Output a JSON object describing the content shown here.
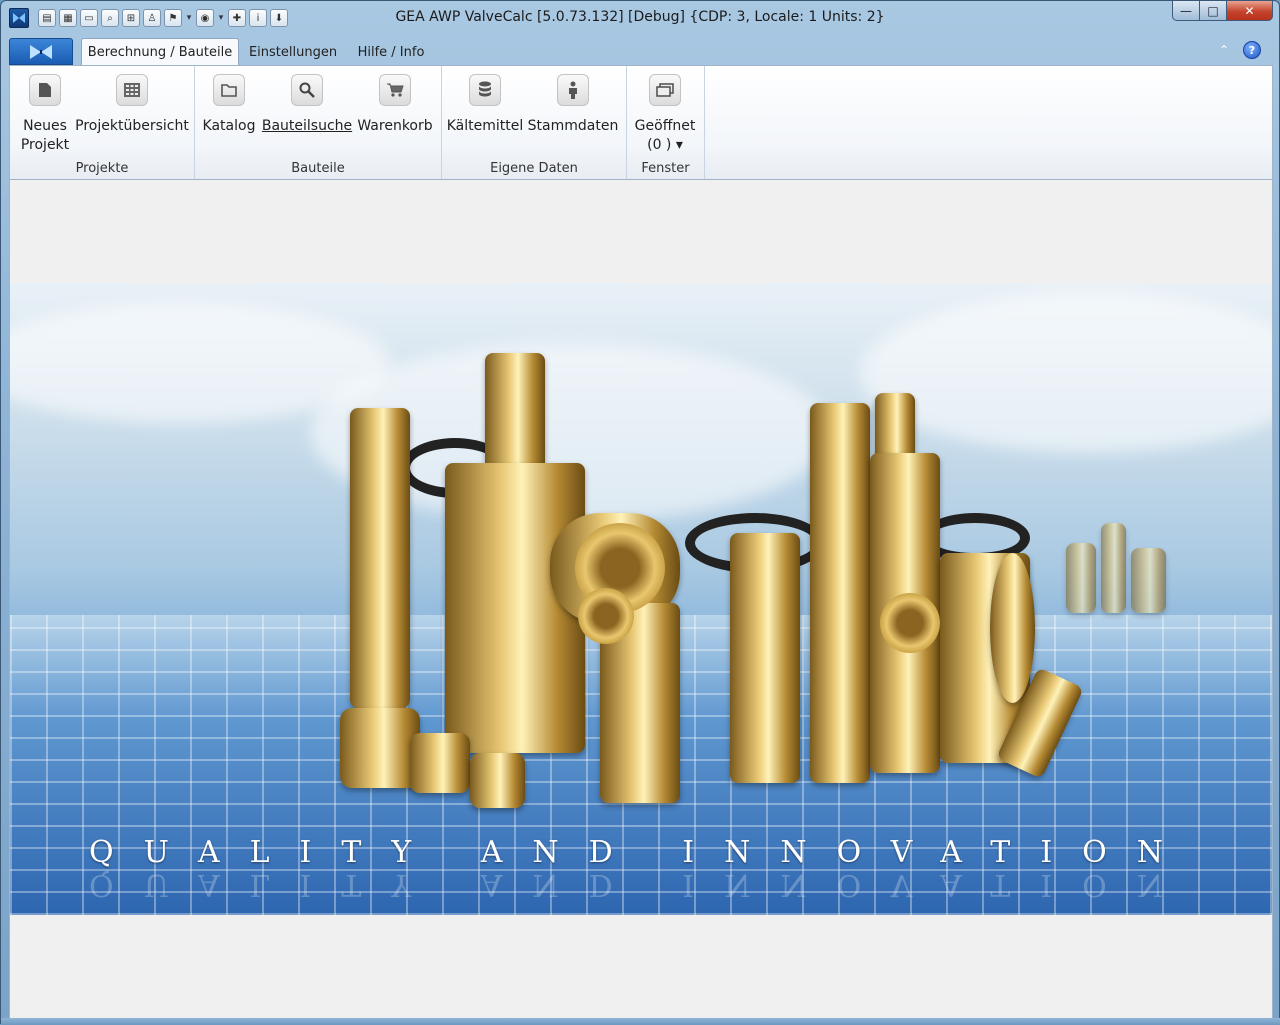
{
  "window": {
    "title": "GEA AWP ValveCalc [5.0.73.132] [Debug] {CDP: 3, Locale: 1 Units: 2}",
    "controls": {
      "minimize": "—",
      "maximize": "□",
      "close": "✕"
    }
  },
  "quick_access": [
    {
      "icon": "new-document-icon",
      "glyph": "▤"
    },
    {
      "icon": "grid-icon",
      "glyph": "▦"
    },
    {
      "icon": "folder-icon",
      "glyph": "▭"
    },
    {
      "icon": "search-icon",
      "glyph": "⌕"
    },
    {
      "icon": "cart-icon",
      "glyph": "⊞"
    },
    {
      "icon": "person-icon",
      "glyph": "♙"
    },
    {
      "icon": "flag-icon",
      "glyph": "⚑"
    },
    {
      "icon": "globe-icon",
      "glyph": "◉"
    },
    {
      "icon": "plus-icon",
      "glyph": "✚"
    },
    {
      "icon": "info-icon",
      "glyph": "i"
    },
    {
      "icon": "download-icon",
      "glyph": "⬇"
    }
  ],
  "tabs": [
    {
      "label": "Berechnung / Bauteile",
      "active": true
    },
    {
      "label": "Einstellungen",
      "active": false
    },
    {
      "label": "Hilfe / Info",
      "active": false
    }
  ],
  "help_label": "?",
  "collapse_glyph": "⌃",
  "ribbon": {
    "groups": [
      {
        "label": "Projekte",
        "buttons": [
          {
            "label_line1": "Neues",
            "label_line2": "Projekt",
            "icon": "new-project-icon"
          },
          {
            "label_line1": "Projektübersicht",
            "label_line2": "",
            "icon": "project-overview-icon"
          }
        ]
      },
      {
        "label": "Bauteile",
        "buttons": [
          {
            "label_line1": "Katalog",
            "label_line2": "",
            "icon": "catalog-icon"
          },
          {
            "label_line1": "Bauteilsuche",
            "label_line2": "",
            "icon": "component-search-icon"
          },
          {
            "label_line1": "Warenkorb",
            "label_line2": "",
            "icon": "shopping-cart-icon"
          }
        ]
      },
      {
        "label": "Eigene Daten",
        "buttons": [
          {
            "label_line1": "Kältemittel",
            "label_line2": "",
            "icon": "refrigerant-icon"
          },
          {
            "label_line1": "Stammdaten",
            "label_line2": "",
            "icon": "master-data-icon"
          }
        ]
      },
      {
        "label": "Fenster",
        "buttons": [
          {
            "label_line1": "Geöffnet",
            "label_line2": "(0 ) ▾",
            "icon": "windows-icon"
          }
        ]
      }
    ]
  },
  "banner": {
    "motto": "QUALITY AND INNOVATION"
  },
  "colors": {
    "frame": "#8fb4d6",
    "ribbon_bg": "#f3f6fa",
    "content_bg": "#f0f0f0",
    "close_red": "#c6442c"
  }
}
